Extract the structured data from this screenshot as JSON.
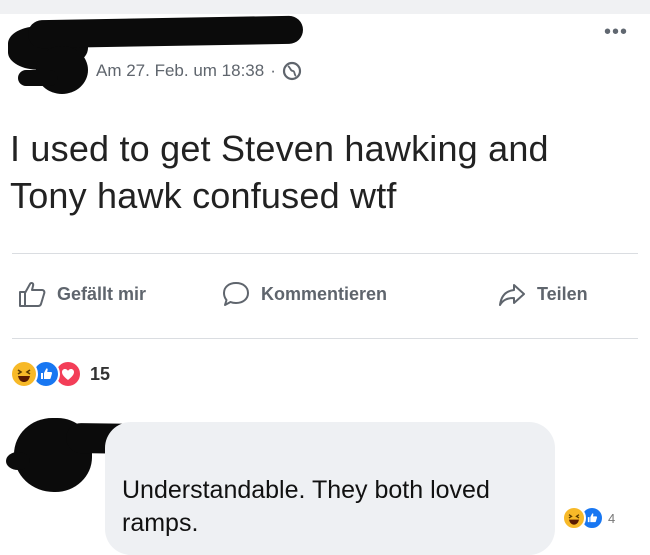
{
  "post": {
    "timestamp": "Am 27. Feb. um 18:38",
    "separator": "·",
    "privacy_icon": "globe-icon",
    "more_icon": "more-options-icon",
    "text": "I used to get Steven hawking and Tony hawk confused wtf"
  },
  "actions": {
    "like_label": "Gefällt mir",
    "comment_label": "Kommentieren",
    "share_label": "Teilen"
  },
  "reactions": {
    "icons": [
      "haha-reaction-icon",
      "like-reaction-icon",
      "love-reaction-icon"
    ],
    "count": "15"
  },
  "comment": {
    "text": "Understandable. They both loved ramps.",
    "reactions": [
      "haha-reaction-icon",
      "like-reaction-icon"
    ],
    "reaction_count": "4"
  },
  "colors": {
    "meta_text": "#5f656d",
    "divider": "#dadde1",
    "like_blue": "#1877f2",
    "love_red": "#f33e58",
    "haha_yellow": "#f7b928",
    "comment_bg": "#eef0f3"
  }
}
